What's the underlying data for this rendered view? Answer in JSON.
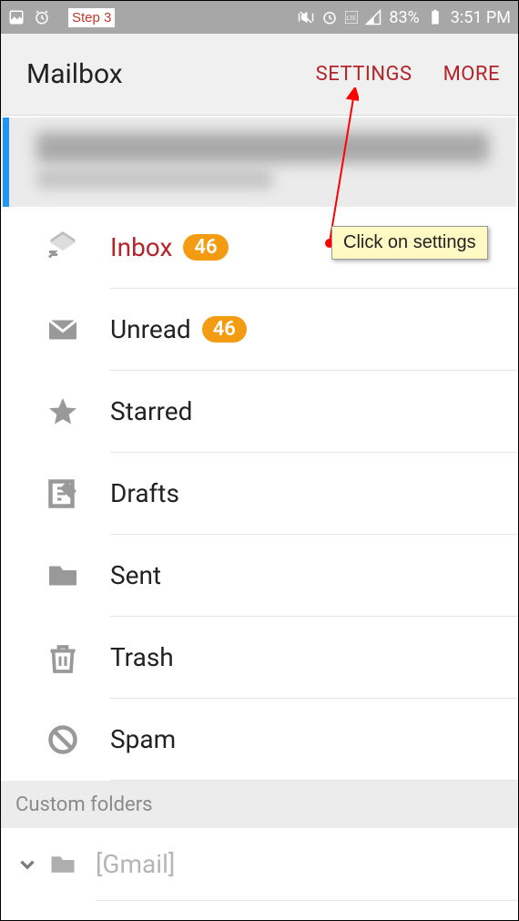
{
  "annotation": {
    "step": "Step 3",
    "tooltip": "Click on settings"
  },
  "status": {
    "battery": "83%",
    "time": "3:51 PM"
  },
  "header": {
    "title": "Mailbox",
    "settings": "SETTINGS",
    "more": "MORE"
  },
  "folders": [
    {
      "id": "inbox",
      "label": "Inbox",
      "badge": "46",
      "active": true
    },
    {
      "id": "unread",
      "label": "Unread",
      "badge": "46",
      "active": false
    },
    {
      "id": "starred",
      "label": "Starred",
      "badge": null,
      "active": false
    },
    {
      "id": "drafts",
      "label": "Drafts",
      "badge": null,
      "active": false
    },
    {
      "id": "sent",
      "label": "Sent",
      "badge": null,
      "active": false
    },
    {
      "id": "trash",
      "label": "Trash",
      "badge": null,
      "active": false
    },
    {
      "id": "spam",
      "label": "Spam",
      "badge": null,
      "active": false
    }
  ],
  "custom_section": {
    "title": "Custom folders",
    "items": [
      {
        "label": "[Gmail]"
      }
    ]
  }
}
